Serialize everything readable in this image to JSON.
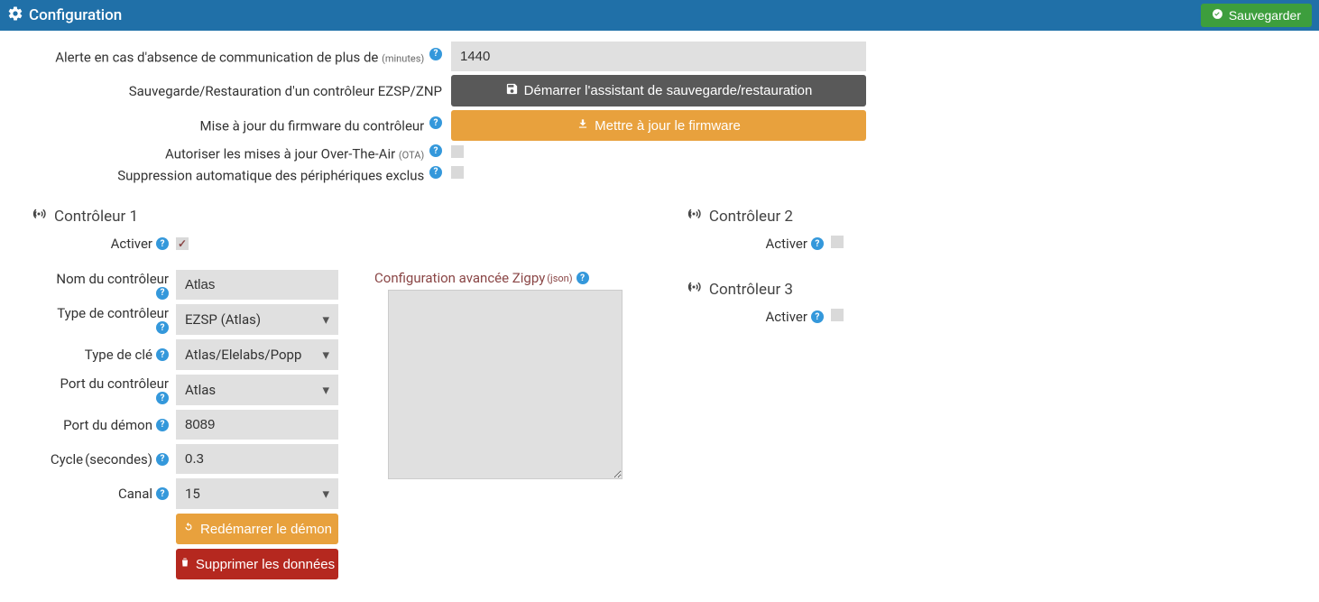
{
  "header": {
    "title": "Configuration",
    "save": "Sauvegarder"
  },
  "top": {
    "alert_label": "Alerte en cas d'absence de communication de plus de ",
    "alert_sub": "(minutes)",
    "alert_value": "1440",
    "backup_label": "Sauvegarde/Restauration d'un contrôleur EZSP/ZNP",
    "backup_btn": "Démarrer l'assistant de sauvegarde/restauration",
    "firmware_label": "Mise à jour du firmware du contrôleur",
    "firmware_btn": "Mettre à jour le firmware",
    "ota_label": "Autoriser les mises à jour Over-The-Air ",
    "ota_sub": "(OTA)",
    "autodel_label": "Suppression automatique des périphériques exclus"
  },
  "c1": {
    "title": "Contrôleur 1",
    "activate": "Activer",
    "name_label": "Nom du contrôleur",
    "name_value": "Atlas",
    "type_label": "Type de contrôleur",
    "type_value": "EZSP (Atlas)",
    "key_label": "Type de clé",
    "key_value": "Atlas/Elelabs/Popp",
    "port_ctrl_label": "Port du contrôleur",
    "port_ctrl_value": "Atlas",
    "port_daemon_label": "Port du démon",
    "port_daemon_value": "8089",
    "cycle_label": "Cycle ",
    "cycle_sub": "(secondes)",
    "cycle_value": "0.3",
    "channel_label": "Canal",
    "channel_value": "15",
    "restart_btn": "Redémarrer le démon",
    "delete_btn": "Supprimer les données",
    "adv_label": "Configuration avancée Zigpy ",
    "adv_sub": "(json)"
  },
  "c2": {
    "title": "Contrôleur 2",
    "activate": "Activer"
  },
  "c3": {
    "title": "Contrôleur 3",
    "activate": "Activer"
  }
}
